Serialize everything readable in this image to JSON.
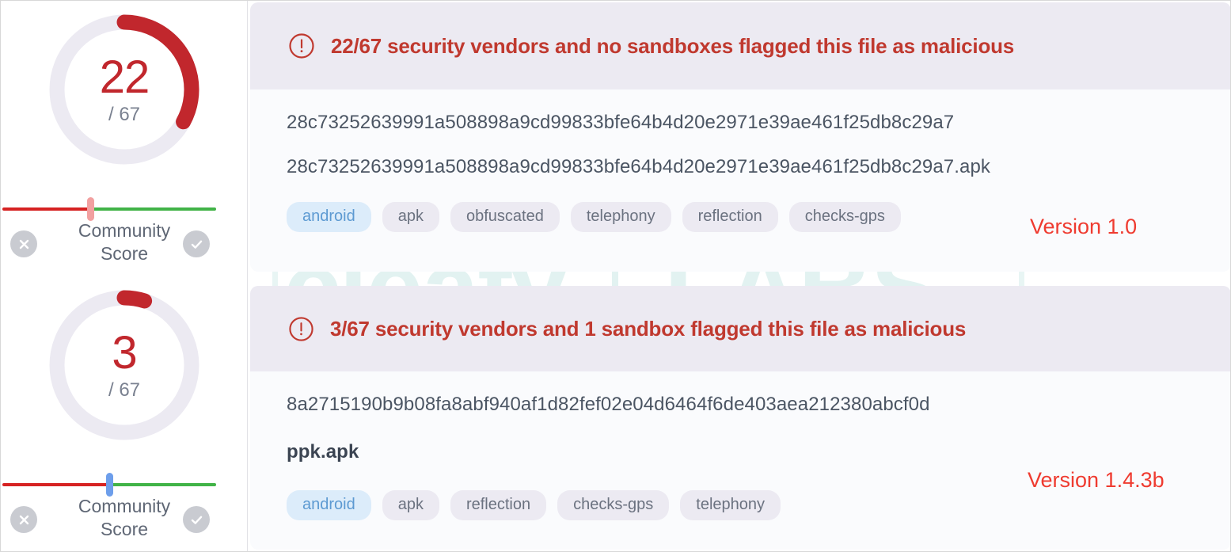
{
  "watermark": {
    "text_left": ".cleafy",
    "text_right": "LABS"
  },
  "sidebar": {
    "gauges": [
      {
        "value": "22",
        "total": "/ 67",
        "percent": 33,
        "arc_color": "#c1272d",
        "track_color": "#eceaf2",
        "community_label_line1": "Community",
        "community_label_line2": "Score",
        "slider": {
          "handle_position_percent": 41,
          "handle_color": "#f2a0a0",
          "left_color": "#d62222",
          "right_color": "#41b347"
        },
        "reject_icon": "close-icon",
        "accept_icon": "check-icon"
      },
      {
        "value": "3",
        "total": "/ 67",
        "percent": 5,
        "arc_color": "#c1272d",
        "track_color": "#eceaf2",
        "community_label_line1": "Community",
        "community_label_line2": "Score",
        "slider": {
          "handle_position_percent": 50,
          "handle_color": "#6d9eeb",
          "left_color": "#d62222",
          "right_color": "#41b347"
        },
        "reject_icon": "close-icon",
        "accept_icon": "check-icon"
      }
    ]
  },
  "reports": [
    {
      "banner_icon": "alert-circle-icon",
      "banner_text": "22/67 security vendors and no sandboxes flagged this file as malicious",
      "banner_color": "#c0392f",
      "hash": "28c73252639991a508898a9cd99833bfe64b4d20e2971e39ae461f25db8c29a7",
      "filename": "28c73252639991a508898a9cd99833bfe64b4d20e2971e39ae461f25db8c29a7.apk",
      "tags": [
        "android",
        "apk",
        "obfuscated",
        "telephony",
        "reflection",
        "checks-gps"
      ],
      "version_label": "Version 1.0"
    },
    {
      "banner_icon": "alert-circle-icon",
      "banner_text": "3/67 security vendors and 1 sandbox flagged this file as malicious",
      "banner_color": "#c0392f",
      "hash": "8a2715190b9b08fa8abf940af1d82fef02e04d6464f6de403aea212380abcf0d",
      "filename": "ppk.apk",
      "tags": [
        "android",
        "apk",
        "reflection",
        "checks-gps",
        "telephony"
      ],
      "version_label": "Version 1.4.3b"
    }
  ]
}
